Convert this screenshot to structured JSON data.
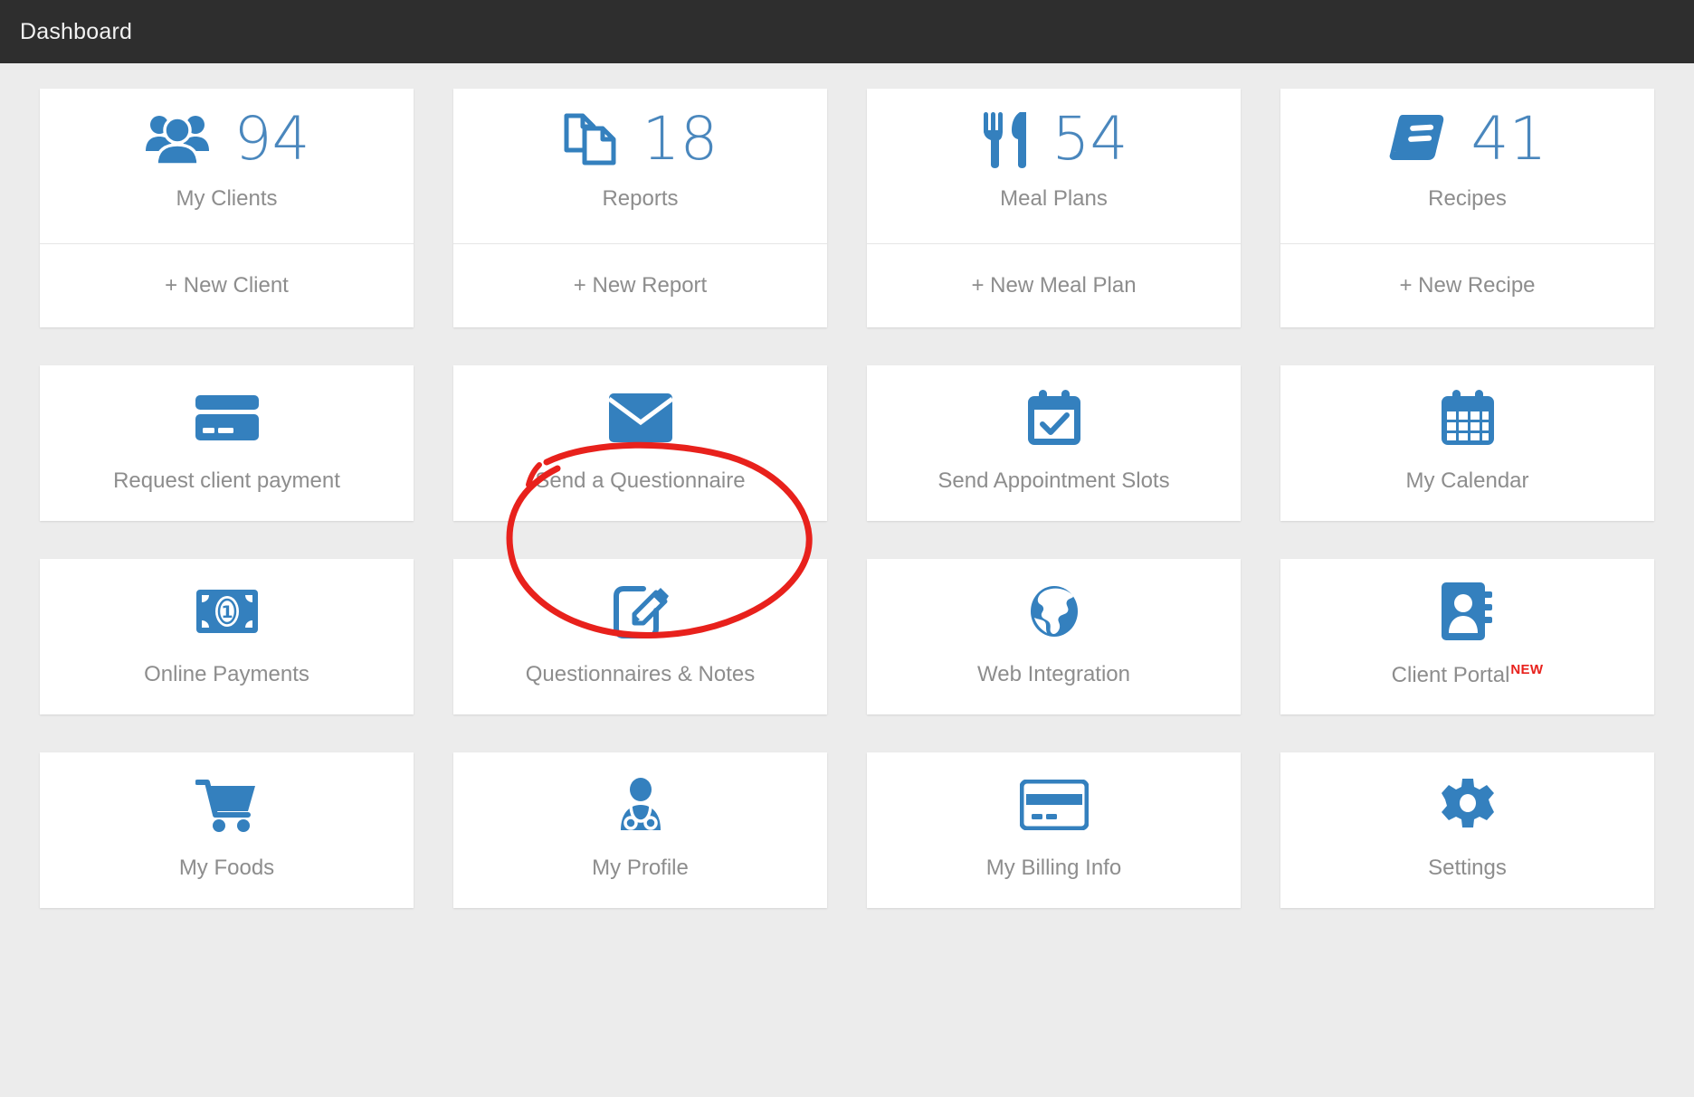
{
  "header": {
    "title": "Dashboard"
  },
  "colors": {
    "accent_blue": "#3480BE",
    "number_blue": "#4A87BD",
    "label_gray": "#8D8D8D",
    "topbar": "#2E2E2E",
    "page_bg": "#ECECEC",
    "annotation_red": "#E8211C",
    "badge_red": "#E8211C"
  },
  "stats_row": [
    {
      "icon": "users-icon",
      "count": "94",
      "label": "My Clients",
      "action": "+ New Client"
    },
    {
      "icon": "reports-icon",
      "count": "18",
      "label": "Reports",
      "action": "+ New Report"
    },
    {
      "icon": "cutlery-icon",
      "count": "54",
      "label": "Meal Plans",
      "action": "+ New Meal Plan"
    },
    {
      "icon": "book-icon",
      "count": "41",
      "label": "Recipes",
      "action": "+ New Recipe"
    }
  ],
  "tile_rows": [
    [
      {
        "icon": "credit-card-icon",
        "label": "Request client payment",
        "badge": ""
      },
      {
        "icon": "envelope-icon",
        "label": "Send a Questionnaire",
        "badge": "",
        "annotated": true
      },
      {
        "icon": "calendar-check-icon",
        "label": "Send Appointment Slots",
        "badge": ""
      },
      {
        "icon": "calendar-grid-icon",
        "label": "My Calendar",
        "badge": ""
      }
    ],
    [
      {
        "icon": "banknote-icon",
        "label": "Online Payments",
        "badge": ""
      },
      {
        "icon": "edit-note-icon",
        "label": "Questionnaires & Notes",
        "badge": ""
      },
      {
        "icon": "globe-icon",
        "label": "Web Integration",
        "badge": ""
      },
      {
        "icon": "address-book-icon",
        "label": "Client Portal",
        "badge": "NEW"
      }
    ],
    [
      {
        "icon": "shopping-cart-icon",
        "label": "My Foods",
        "badge": ""
      },
      {
        "icon": "doctor-icon",
        "label": "My Profile",
        "badge": ""
      },
      {
        "icon": "billing-card-icon",
        "label": "My Billing Info",
        "badge": ""
      },
      {
        "icon": "gear-icon",
        "label": "Settings",
        "badge": ""
      }
    ]
  ],
  "annotation": {
    "shape": "hand-drawn-ellipse",
    "target": "Send a Questionnaire",
    "color": "#E8211C"
  }
}
